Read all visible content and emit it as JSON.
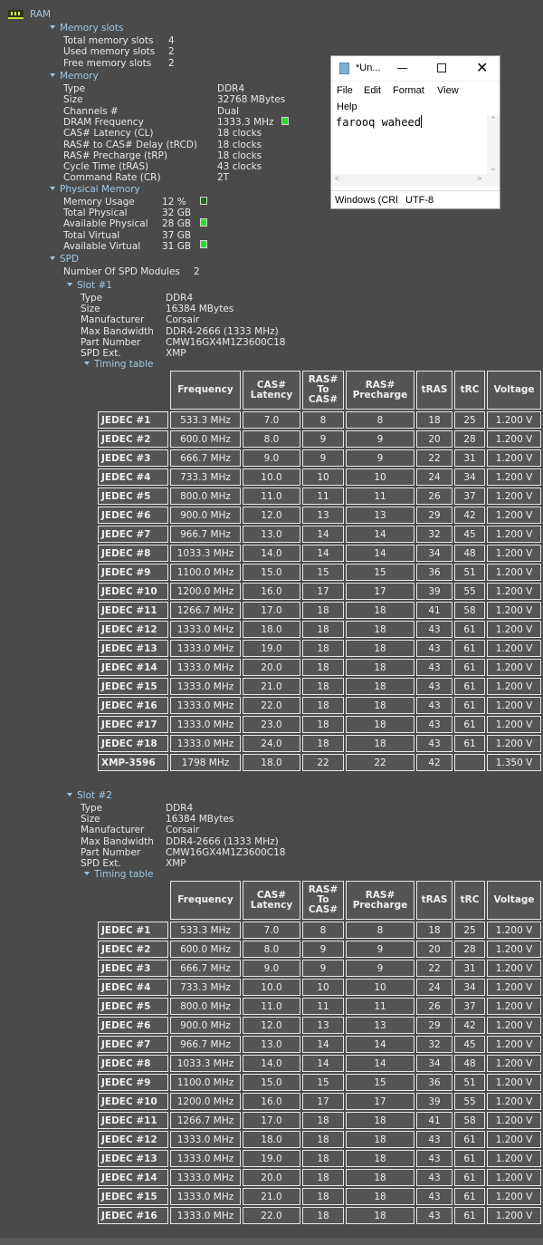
{
  "root": {
    "label": "RAM",
    "icon": "ram-module-icon"
  },
  "memory_slots": {
    "title": "Memory slots",
    "items": [
      {
        "label": "Total memory slots",
        "value": "4"
      },
      {
        "label": "Used memory slots",
        "value": "2"
      },
      {
        "label": "Free memory slots",
        "value": "2"
      }
    ]
  },
  "memory": {
    "title": "Memory",
    "items": [
      {
        "label": "Type",
        "value": "DDR4"
      },
      {
        "label": "Size",
        "value": "32768 MBytes"
      },
      {
        "label": "Channels #",
        "value": "Dual"
      },
      {
        "label": "DRAM Frequency",
        "value": "1333.3 MHz"
      },
      {
        "label": "CAS# Latency (CL)",
        "value": "18 clocks"
      },
      {
        "label": "RAS# to CAS# Delay (tRCD)",
        "value": "18 clocks"
      },
      {
        "label": "RAS# Precharge (tRP)",
        "value": "18 clocks"
      },
      {
        "label": "Cycle Time (tRAS)",
        "value": "43 clocks"
      },
      {
        "label": "Command Rate (CR)",
        "value": "2T"
      }
    ]
  },
  "physical_memory": {
    "title": "Physical Memory",
    "items": [
      {
        "label": "Memory Usage",
        "value": "12 %"
      },
      {
        "label": "Total Physical",
        "value": "32 GB"
      },
      {
        "label": "Available Physical",
        "value": "28 GB"
      },
      {
        "label": "Total Virtual",
        "value": "37 GB"
      },
      {
        "label": "Available Virtual",
        "value": "31 GB"
      }
    ]
  },
  "spd": {
    "title": "SPD",
    "modules_label": "Number Of SPD Modules",
    "modules_value": "2",
    "timing_table_label": "Timing table",
    "columns": [
      "",
      "Frequency",
      "CAS#\nLatency",
      "RAS#\nTo\nCAS#",
      "RAS#\nPrecharge",
      "tRAS",
      "tRC",
      "Voltage"
    ],
    "slots": [
      {
        "title": "Slot #1",
        "items": [
          {
            "label": "Type",
            "value": "DDR4"
          },
          {
            "label": "Size",
            "value": "16384 MBytes"
          },
          {
            "label": "Manufacturer",
            "value": "Corsair"
          },
          {
            "label": "Max Bandwidth",
            "value": "DDR4-2666 (1333 MHz)"
          },
          {
            "label": "Part Number",
            "value": "CMW16GX4M1Z3600C18"
          },
          {
            "label": "SPD Ext.",
            "value": "XMP"
          }
        ],
        "rows": [
          [
            "JEDEC #1",
            "533.3 MHz",
            "7.0",
            "8",
            "8",
            "18",
            "25",
            "1.200 V"
          ],
          [
            "JEDEC #2",
            "600.0 MHz",
            "8.0",
            "9",
            "9",
            "20",
            "28",
            "1.200 V"
          ],
          [
            "JEDEC #3",
            "666.7 MHz",
            "9.0",
            "9",
            "9",
            "22",
            "31",
            "1.200 V"
          ],
          [
            "JEDEC #4",
            "733.3 MHz",
            "10.0",
            "10",
            "10",
            "24",
            "34",
            "1.200 V"
          ],
          [
            "JEDEC #5",
            "800.0 MHz",
            "11.0",
            "11",
            "11",
            "26",
            "37",
            "1.200 V"
          ],
          [
            "JEDEC #6",
            "900.0 MHz",
            "12.0",
            "13",
            "13",
            "29",
            "42",
            "1.200 V"
          ],
          [
            "JEDEC #7",
            "966.7 MHz",
            "13.0",
            "14",
            "14",
            "32",
            "45",
            "1.200 V"
          ],
          [
            "JEDEC #8",
            "1033.3 MHz",
            "14.0",
            "14",
            "14",
            "34",
            "48",
            "1.200 V"
          ],
          [
            "JEDEC #9",
            "1100.0 MHz",
            "15.0",
            "15",
            "15",
            "36",
            "51",
            "1.200 V"
          ],
          [
            "JEDEC #10",
            "1200.0 MHz",
            "16.0",
            "17",
            "17",
            "39",
            "55",
            "1.200 V"
          ],
          [
            "JEDEC #11",
            "1266.7 MHz",
            "17.0",
            "18",
            "18",
            "41",
            "58",
            "1.200 V"
          ],
          [
            "JEDEC #12",
            "1333.0 MHz",
            "18.0",
            "18",
            "18",
            "43",
            "61",
            "1.200 V"
          ],
          [
            "JEDEC #13",
            "1333.0 MHz",
            "19.0",
            "18",
            "18",
            "43",
            "61",
            "1.200 V"
          ],
          [
            "JEDEC #14",
            "1333.0 MHz",
            "20.0",
            "18",
            "18",
            "43",
            "61",
            "1.200 V"
          ],
          [
            "JEDEC #15",
            "1333.0 MHz",
            "21.0",
            "18",
            "18",
            "43",
            "61",
            "1.200 V"
          ],
          [
            "JEDEC #16",
            "1333.0 MHz",
            "22.0",
            "18",
            "18",
            "43",
            "61",
            "1.200 V"
          ],
          [
            "JEDEC #17",
            "1333.0 MHz",
            "23.0",
            "18",
            "18",
            "43",
            "61",
            "1.200 V"
          ],
          [
            "JEDEC #18",
            "1333.0 MHz",
            "24.0",
            "18",
            "18",
            "43",
            "61",
            "1.200 V"
          ],
          [
            "XMP-3596",
            "1798 MHz",
            "18.0",
            "22",
            "22",
            "42",
            "",
            "1.350 V"
          ]
        ]
      },
      {
        "title": "Slot #2",
        "items": [
          {
            "label": "Type",
            "value": "DDR4"
          },
          {
            "label": "Size",
            "value": "16384 MBytes"
          },
          {
            "label": "Manufacturer",
            "value": "Corsair"
          },
          {
            "label": "Max Bandwidth",
            "value": "DDR4-2666 (1333 MHz)"
          },
          {
            "label": "Part Number",
            "value": "CMW16GX4M1Z3600C18"
          },
          {
            "label": "SPD Ext.",
            "value": "XMP"
          }
        ],
        "rows": [
          [
            "JEDEC #1",
            "533.3 MHz",
            "7.0",
            "8",
            "8",
            "18",
            "25",
            "1.200 V"
          ],
          [
            "JEDEC #2",
            "600.0 MHz",
            "8.0",
            "9",
            "9",
            "20",
            "28",
            "1.200 V"
          ],
          [
            "JEDEC #3",
            "666.7 MHz",
            "9.0",
            "9",
            "9",
            "22",
            "31",
            "1.200 V"
          ],
          [
            "JEDEC #4",
            "733.3 MHz",
            "10.0",
            "10",
            "10",
            "24",
            "34",
            "1.200 V"
          ],
          [
            "JEDEC #5",
            "800.0 MHz",
            "11.0",
            "11",
            "11",
            "26",
            "37",
            "1.200 V"
          ],
          [
            "JEDEC #6",
            "900.0 MHz",
            "12.0",
            "13",
            "13",
            "29",
            "42",
            "1.200 V"
          ],
          [
            "JEDEC #7",
            "966.7 MHz",
            "13.0",
            "14",
            "14",
            "32",
            "45",
            "1.200 V"
          ],
          [
            "JEDEC #8",
            "1033.3 MHz",
            "14.0",
            "14",
            "14",
            "34",
            "48",
            "1.200 V"
          ],
          [
            "JEDEC #9",
            "1100.0 MHz",
            "15.0",
            "15",
            "15",
            "36",
            "51",
            "1.200 V"
          ],
          [
            "JEDEC #10",
            "1200.0 MHz",
            "16.0",
            "17",
            "17",
            "39",
            "55",
            "1.200 V"
          ],
          [
            "JEDEC #11",
            "1266.7 MHz",
            "17.0",
            "18",
            "18",
            "41",
            "58",
            "1.200 V"
          ],
          [
            "JEDEC #12",
            "1333.0 MHz",
            "18.0",
            "18",
            "18",
            "43",
            "61",
            "1.200 V"
          ],
          [
            "JEDEC #13",
            "1333.0 MHz",
            "19.0",
            "18",
            "18",
            "43",
            "61",
            "1.200 V"
          ],
          [
            "JEDEC #14",
            "1333.0 MHz",
            "20.0",
            "18",
            "18",
            "43",
            "61",
            "1.200 V"
          ],
          [
            "JEDEC #15",
            "1333.0 MHz",
            "21.0",
            "18",
            "18",
            "43",
            "61",
            "1.200 V"
          ],
          [
            "JEDEC #16",
            "1333.0 MHz",
            "22.0",
            "18",
            "18",
            "43",
            "61",
            "1.200 V"
          ]
        ]
      }
    ]
  },
  "notepad": {
    "title": "*Un...",
    "menu": [
      "File",
      "Edit",
      "Format",
      "View",
      "Help"
    ],
    "content": "farooq waheed",
    "status_line_ending": "Windows (CRl",
    "status_encoding": "UTF-8",
    "controls": {
      "minimize": "minimize-icon",
      "maximize": "maximize-icon",
      "close": "close-icon"
    }
  }
}
